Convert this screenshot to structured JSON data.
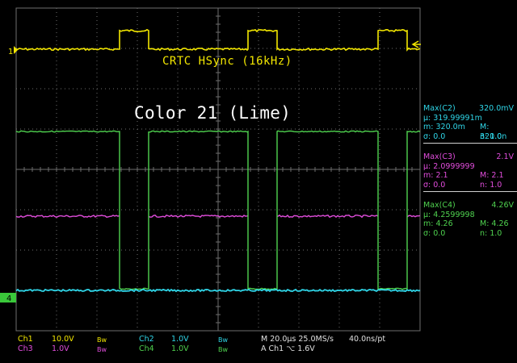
{
  "trace_label": "CRTC HSync (16kHz)",
  "overlay_title": "Color 21 (Lime)",
  "markers": {
    "ch1": "1",
    "ch4": "4"
  },
  "colors": {
    "ch1": "#f2e600",
    "ch2": "#2fd6e8",
    "ch3": "#e14ddc",
    "ch4": "#4fd24f",
    "grid": "#6e6e6e",
    "background": "#000000"
  },
  "measurements": [
    {
      "id": "c2",
      "title": "Max(C2)",
      "value": "320.0mV",
      "mean": "µ: 319.99991m",
      "min": "m: 320.0m",
      "max": "M: 320.0n",
      "sigma": "σ: 0.0",
      "n": "n: 1.0"
    },
    {
      "id": "c3",
      "title": "Max(C3)",
      "value": "2.1V",
      "mean": "µ: 2.0999999",
      "min": "m: 2.1",
      "max": "M: 2.1",
      "sigma": "σ: 0.0",
      "n": "n: 1.0"
    },
    {
      "id": "c4",
      "title": "Max(C4)",
      "value": "4.26V",
      "mean": "µ: 4.2599998",
      "min": "m: 4.26",
      "max": "M: 4.26",
      "sigma": "σ: 0.0",
      "n": "n: 1.0"
    }
  ],
  "status": {
    "ch1_name": "Ch1",
    "ch1_scale": "10.0V",
    "ch2_name": "Ch2",
    "ch2_scale": "1.0V",
    "ch3_name": "Ch3",
    "ch3_scale": "1.0V",
    "ch4_name": "Ch4",
    "ch4_scale": "1.0V",
    "bw": "Bw",
    "timebase": "M 20.0µs 25.0MS/s",
    "sample": "40.0ns/pt",
    "trigger": "A  Ch1  ⌥  1.6V"
  }
}
